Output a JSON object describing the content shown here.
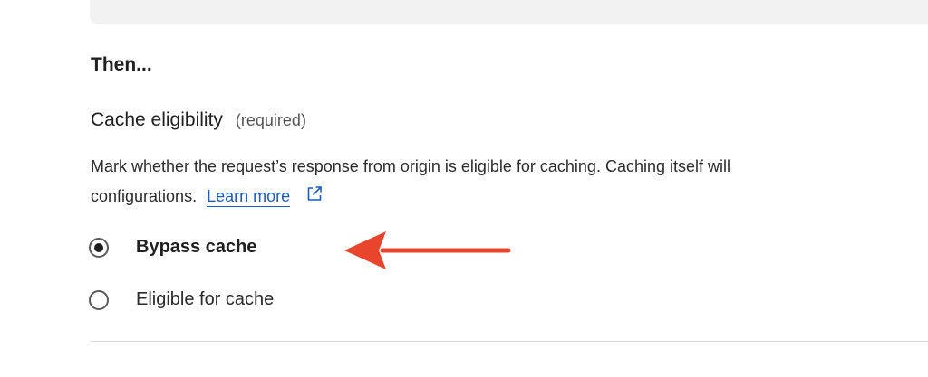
{
  "section": {
    "heading": "Then..."
  },
  "cache_eligibility": {
    "title": "Cache eligibility",
    "required_label": "(required)",
    "description_line1": "Mark whether the request’s response from origin is eligible for caching. Caching itself will",
    "description_line2_prefix": "configurations.",
    "learn_more_label": "Learn more",
    "link_color": "#1d5bbf",
    "options": [
      {
        "label": "Bypass cache",
        "selected": true
      },
      {
        "label": "Eligible for cache",
        "selected": false
      }
    ]
  },
  "annotation": {
    "arrow_color": "#e8452c",
    "arrow_target": "Bypass cache"
  },
  "icons": {
    "external_link": "external-link-icon",
    "radio_selected": "radio-selected-icon",
    "radio_unselected": "radio-unselected-icon",
    "arrow": "left-arrow-icon"
  }
}
